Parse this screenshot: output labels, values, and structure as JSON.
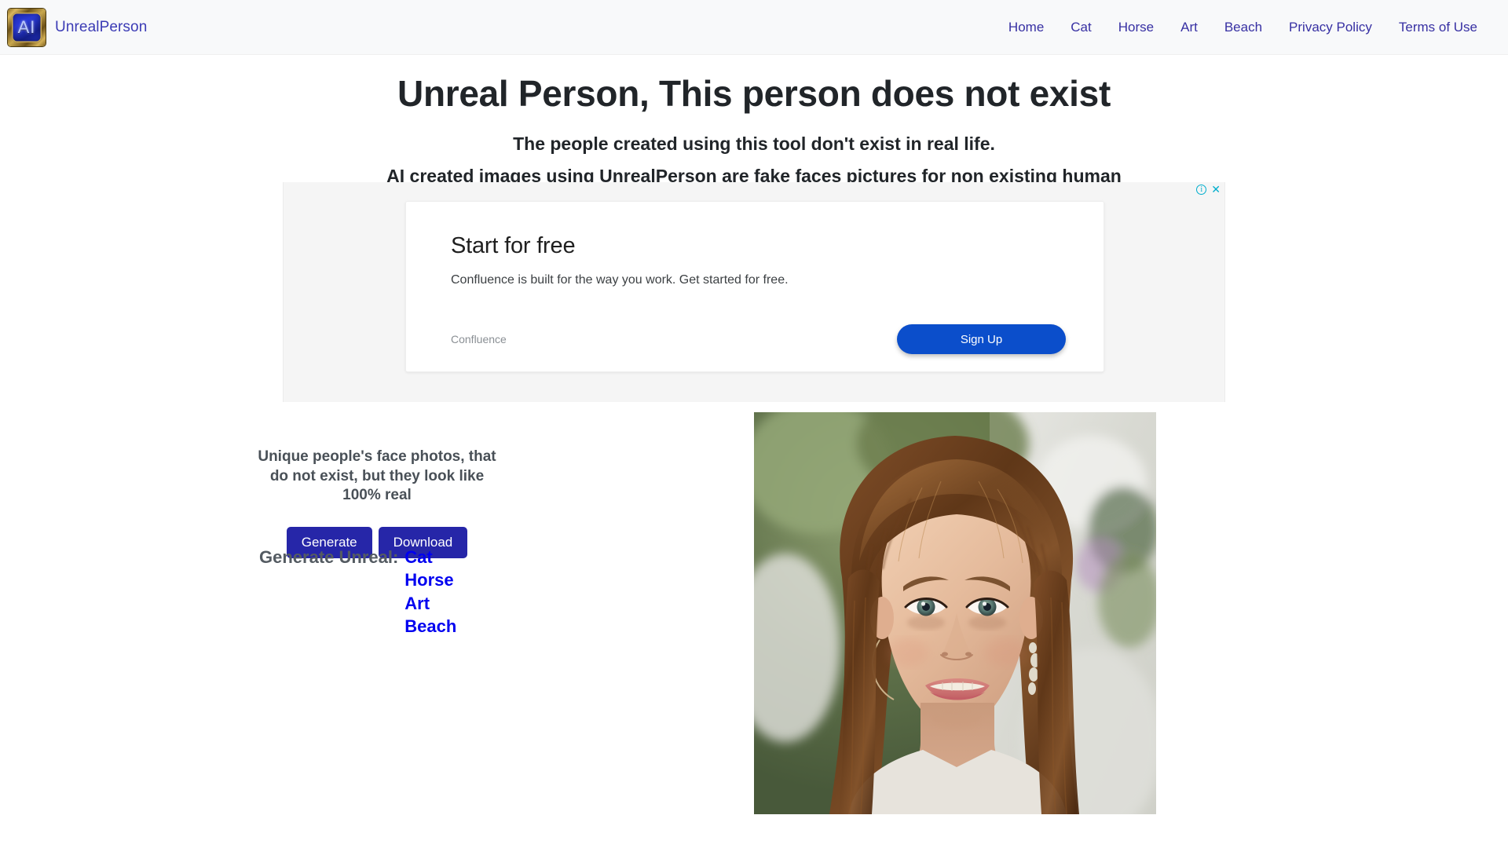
{
  "header": {
    "logo_text": "AI",
    "logo_icon": "ai-badge-icon",
    "brand": "UnrealPerson",
    "nav": [
      {
        "label": "Home"
      },
      {
        "label": "Cat"
      },
      {
        "label": "Horse"
      },
      {
        "label": "Art"
      },
      {
        "label": "Beach"
      },
      {
        "label": "Privacy Policy"
      },
      {
        "label": "Terms of Use"
      }
    ]
  },
  "hero": {
    "title": "Unreal Person, This person does not exist",
    "subtitle_1": "The people created using this tool don't exist in real life.",
    "subtitle_2": "AI created images using UnrealPerson are fake faces pictures for non existing human"
  },
  "ad": {
    "info_icon": "ad-info-icon",
    "close_icon": "ad-close-icon",
    "headline": "Start for free",
    "body": "Confluence is built for the way you work. Get started for free.",
    "brand": "Confluence",
    "cta_label": "Sign Up",
    "cta_color": "#0b4ecb"
  },
  "main": {
    "tagline": "Unique people's face photos, that do not exist, but they look like 100% real",
    "generate_label": "Generate",
    "download_label": "Download",
    "button_color": "#2626a8",
    "generate_unreal_label": "Generate Unreal:",
    "generate_links": [
      {
        "label": "Cat"
      },
      {
        "label": "Horse"
      },
      {
        "label": "Art"
      },
      {
        "label": "Beach"
      }
    ],
    "link_color": "#0000f0",
    "portrait_alt": "AI generated portrait of a smiling woman with long brown hair"
  }
}
